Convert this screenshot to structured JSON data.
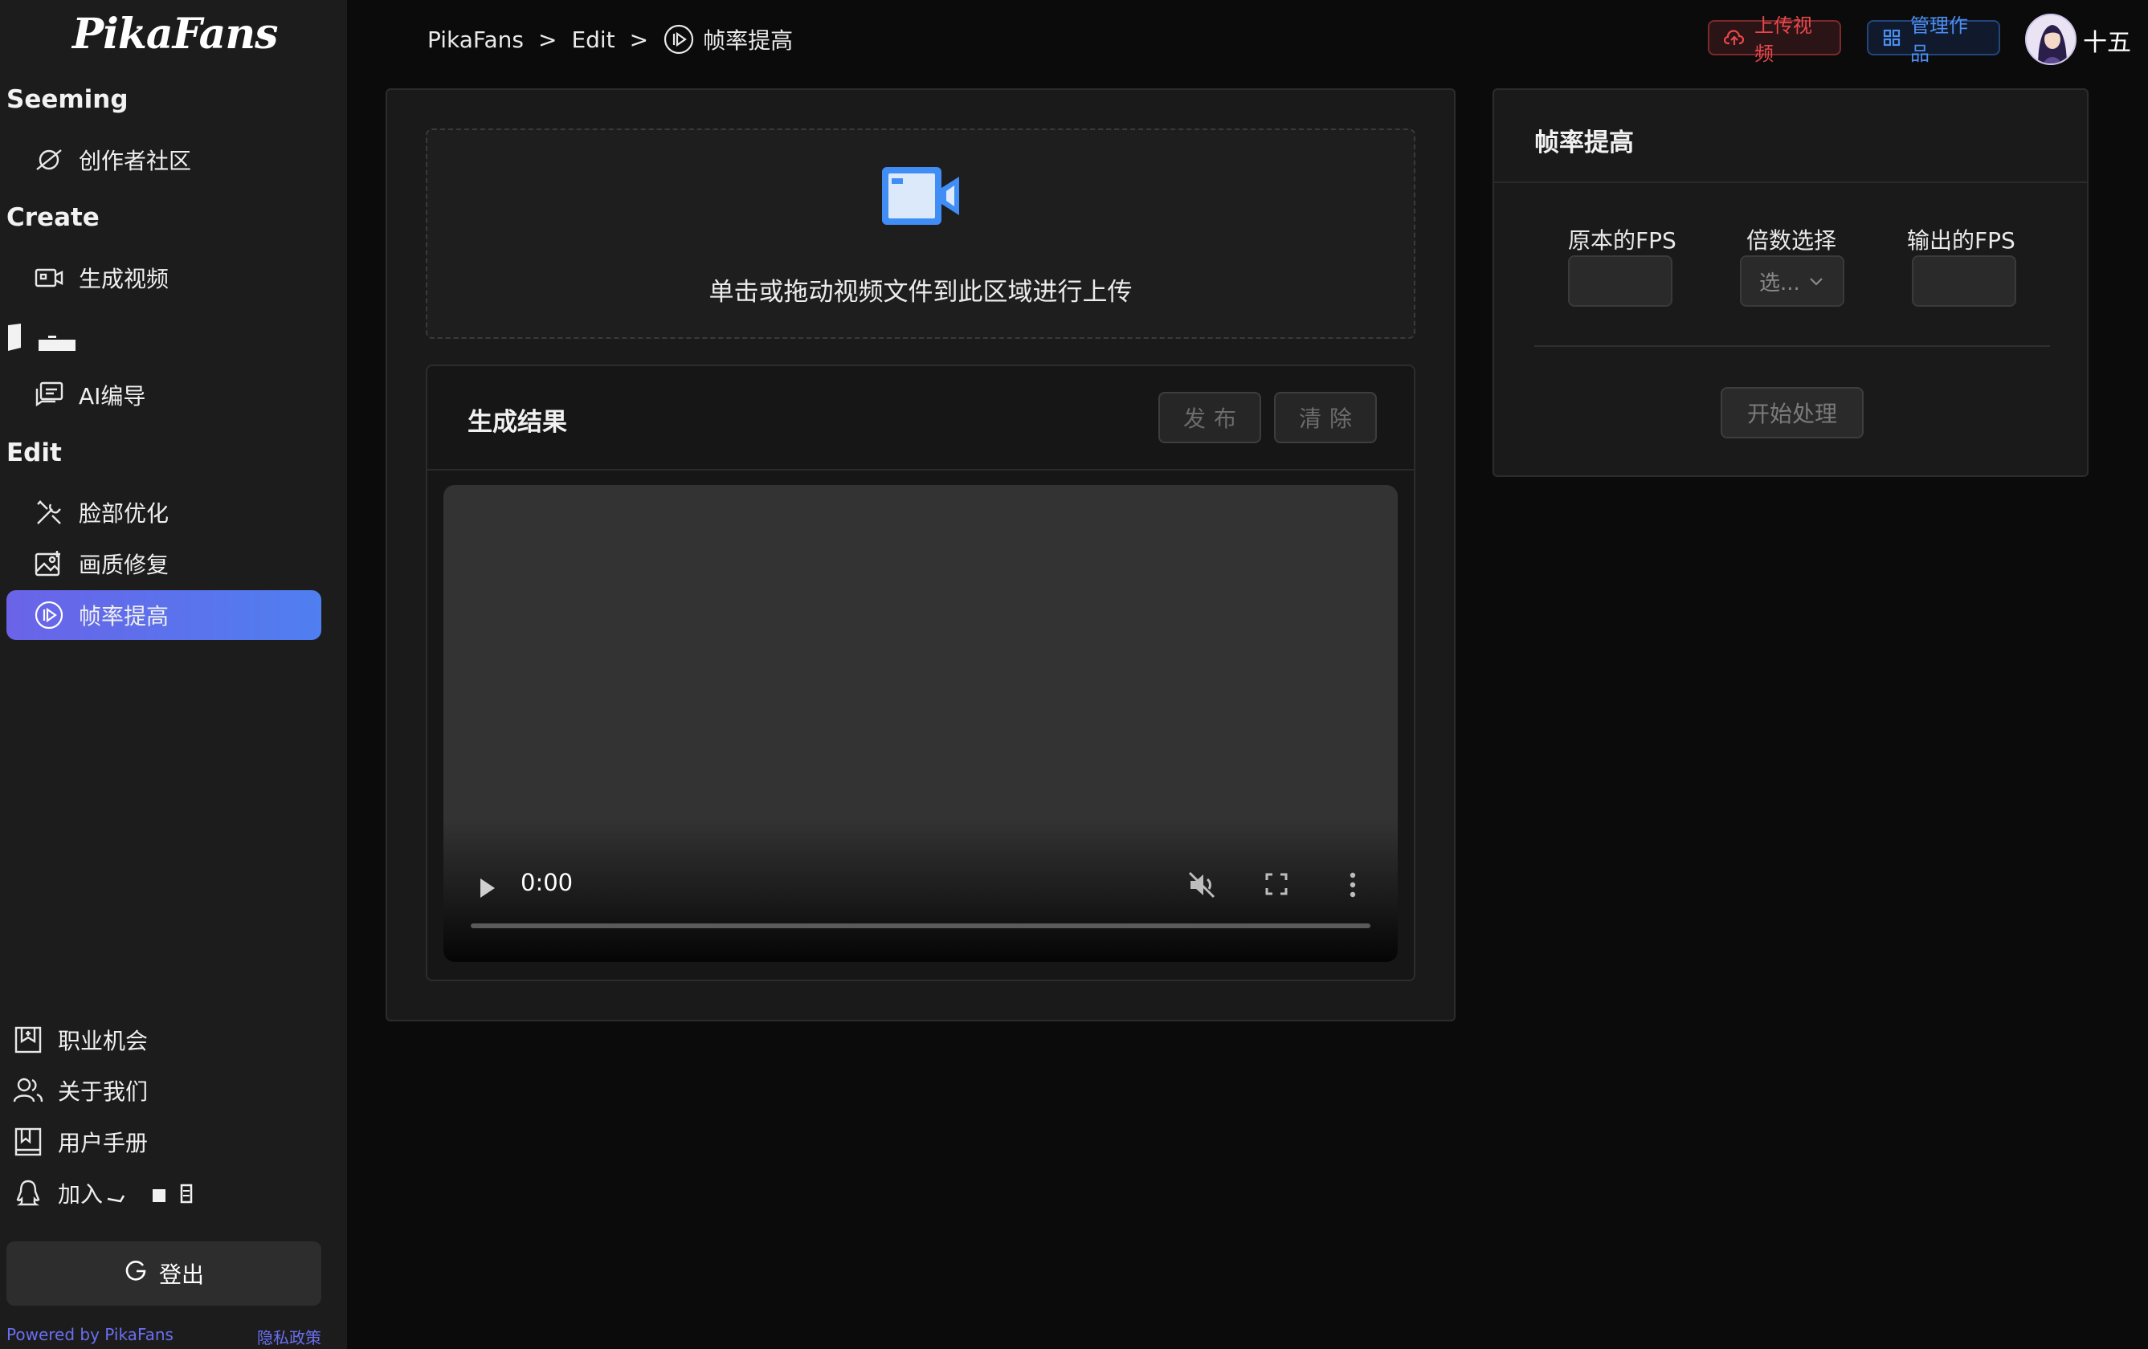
{
  "app": {
    "logo": "PikaFans",
    "user_name": "十五"
  },
  "sidebar": {
    "sections": {
      "seeming": "Seeming",
      "create": "Create",
      "edit": "Edit"
    },
    "items": {
      "community": "创作者社区",
      "generate_video": "生成视频",
      "ai_director": "AI编导",
      "face_optimize": "脸部优化",
      "image_repair": "画质修复",
      "frame_rate": "帧率提高"
    },
    "bottom": {
      "careers": "职业机会",
      "about": "关于我们",
      "manual": "用户手册",
      "join": "加入"
    },
    "logout": "登出",
    "footer": {
      "powered": "Powered by PikaFans",
      "privacy": "隐私政策"
    }
  },
  "header": {
    "breadcrumb": {
      "home": "PikaFans",
      "sep1": ">",
      "section": "Edit",
      "sep2": ">",
      "current": "帧率提高"
    },
    "upload_button": "上传视频",
    "manage_button": "管理作品"
  },
  "main": {
    "dropzone_text": "单击或拖动视频文件到此区域进行上传",
    "result": {
      "title": "生成结果",
      "publish": "发布",
      "clear": "清除"
    },
    "video": {
      "time": "0:00"
    }
  },
  "settings": {
    "title": "帧率提高",
    "original_fps_label": "原本的FPS",
    "multiplier_label": "倍数选择",
    "multiplier_placeholder": "选...",
    "output_fps_label": "输出的FPS",
    "start_button": "开始处理"
  },
  "colors": {
    "active_gradient_start": "#6a63e8",
    "active_gradient_end": "#4f7ff0",
    "upload_accent": "#e8474b",
    "manage_accent": "#4c8ef0",
    "camera_icon": "#3f8df5"
  }
}
